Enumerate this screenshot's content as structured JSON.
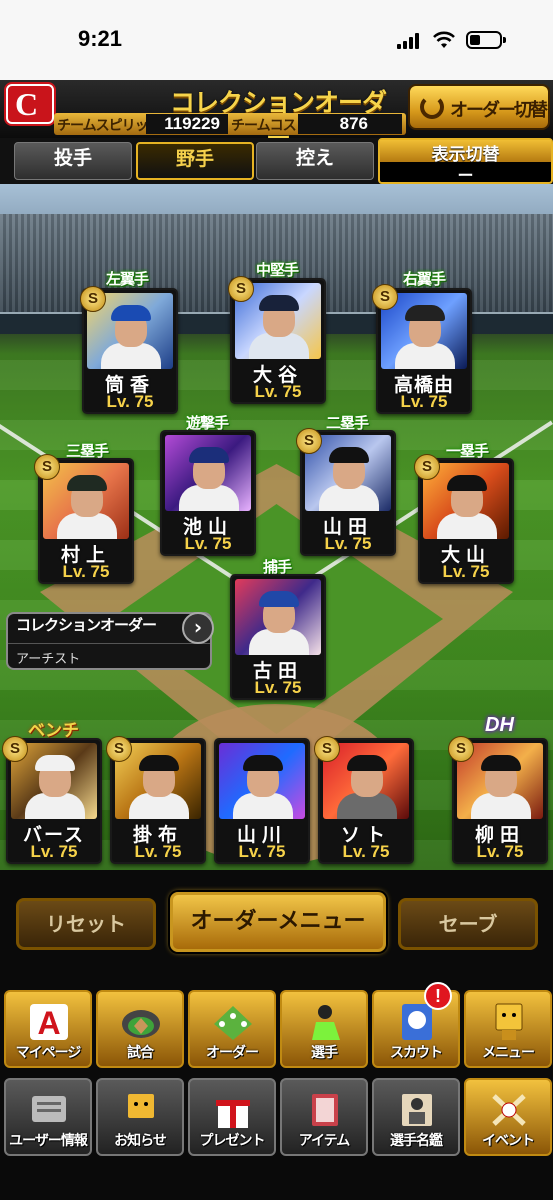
{
  "status_bar": {
    "time": "9:21"
  },
  "header": {
    "title": "コレクションオーダー",
    "team_spirits_label": "チームスピリッツ",
    "team_spirits_value": "119229",
    "team_cost_label": "チームコスト",
    "team_cost_value": "876",
    "order_switch_label": "オーダー切替"
  },
  "tabs": [
    {
      "label": "投手"
    },
    {
      "label": "野手"
    },
    {
      "label": "控え"
    }
  ],
  "active_tab": "野手",
  "display_toggle": {
    "label": "表示切替",
    "value": "ー"
  },
  "positions": {
    "lf": "左翼手",
    "cf": "中堅手",
    "rf": "右翼手",
    "ss": "遊撃手",
    "b2": "二塁手",
    "b3": "三塁手",
    "b1": "一塁手",
    "c": "捕手"
  },
  "players": {
    "lf": {
      "name": "筒香",
      "level": "Lv. 75"
    },
    "cf": {
      "name": "大谷",
      "level": "Lv. 75"
    },
    "rf": {
      "name": "高橋由",
      "level": "Lv. 75"
    },
    "ss": {
      "name": "池山",
      "level": "Lv. 75"
    },
    "b2": {
      "name": "山田",
      "level": "Lv. 75"
    },
    "b3": {
      "name": "村上",
      "level": "Lv. 75"
    },
    "b1": {
      "name": "大山",
      "level": "Lv. 75"
    },
    "c": {
      "name": "古田",
      "level": "Lv. 75"
    }
  },
  "collection_order": {
    "title": "コレクションオーダー",
    "subtitle": "アーチスト"
  },
  "bench_label": "ベンチ",
  "dh_label": "DH",
  "bench": [
    {
      "name": "バース",
      "level": "Lv. 75"
    },
    {
      "name": "掛布",
      "level": "Lv. 75"
    },
    {
      "name": "山川",
      "level": "Lv. 75"
    },
    {
      "name": "ソト",
      "level": "Lv. 75"
    }
  ],
  "dh": {
    "name": "柳田",
    "level": "Lv. 75"
  },
  "card_badge": "S",
  "actions": {
    "reset": "リセット",
    "order_menu": "オーダーメニュー",
    "save": "セーブ"
  },
  "menu_row1": [
    {
      "label": "マイページ",
      "icon": "mypage-icon"
    },
    {
      "label": "試合",
      "icon": "stadium-icon"
    },
    {
      "label": "オーダー",
      "icon": "order-icon"
    },
    {
      "label": "選手",
      "icon": "player-icon"
    },
    {
      "label": "スカウト",
      "icon": "scout-icon"
    },
    {
      "label": "メニュー",
      "icon": "menu-icon"
    }
  ],
  "menu_row2": [
    {
      "label": "ユーザー情報",
      "icon": "user-info-icon"
    },
    {
      "label": "お知らせ",
      "icon": "news-icon"
    },
    {
      "label": "プレゼント",
      "icon": "gift-icon"
    },
    {
      "label": "アイテム",
      "icon": "item-icon"
    },
    {
      "label": "選手名鑑",
      "icon": "directory-icon"
    },
    {
      "label": "イベント",
      "icon": "event-icon"
    }
  ],
  "notification_badge": "!",
  "colors": {
    "accent_gold": "#e6b323",
    "team_red": "#c9141b"
  }
}
